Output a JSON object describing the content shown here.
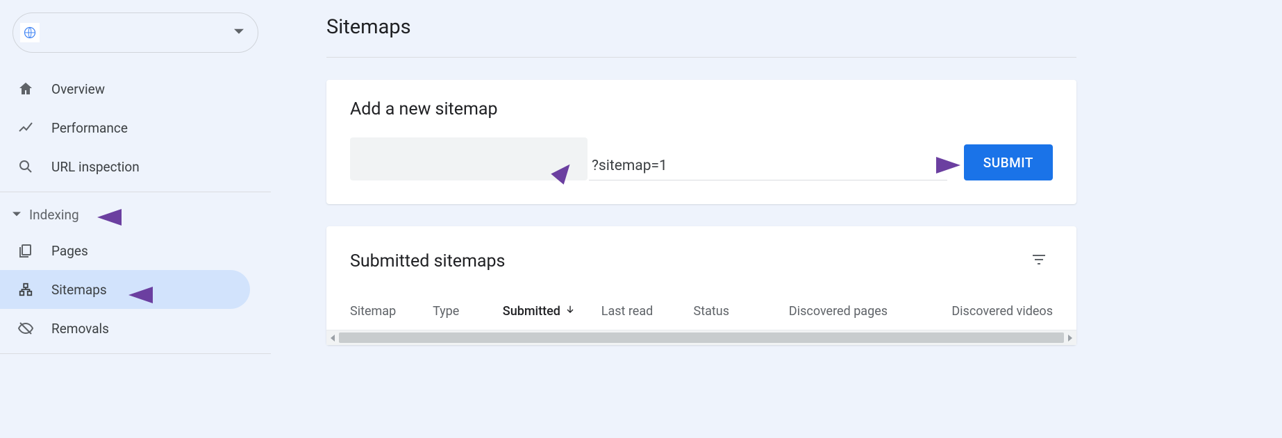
{
  "sidebar": {
    "property_selector": {
      "value": ""
    },
    "nav": {
      "overview": "Overview",
      "performance": "Performance",
      "url_inspection": "URL inspection"
    },
    "section": {
      "indexing": "Indexing"
    },
    "indexing_items": {
      "pages": "Pages",
      "sitemaps": "Sitemaps",
      "removals": "Removals"
    }
  },
  "main": {
    "title": "Sitemaps",
    "add_card": {
      "title": "Add a new sitemap",
      "url_prefix": "",
      "input_value": "?sitemap=1",
      "submit_label": "SUBMIT"
    },
    "submitted_card": {
      "title": "Submitted sitemaps",
      "columns": {
        "sitemap": "Sitemap",
        "type": "Type",
        "submitted": "Submitted",
        "last_read": "Last read",
        "status": "Status",
        "discovered_pages": "Discovered pages",
        "discovered_videos": "Discovered videos"
      },
      "rows": []
    }
  },
  "colors": {
    "annotation_arrow": "#6b3fa0",
    "primary_button": "#1a73e8",
    "active_nav": "#d2e3fc"
  }
}
